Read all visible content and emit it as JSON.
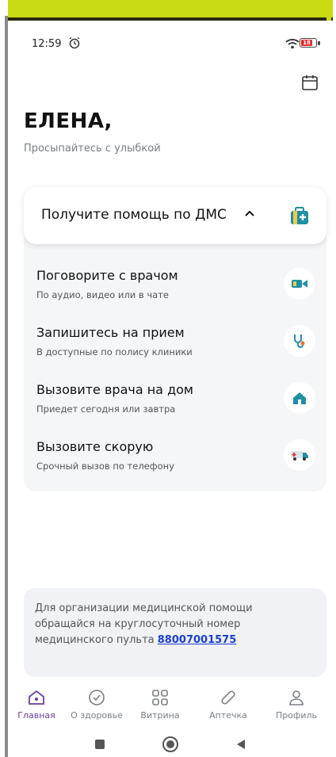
{
  "status_bar": {
    "time": "12:59",
    "battery_level": "18"
  },
  "greeting": {
    "name": "ЕЛЕНА,",
    "subtitle": "Просыпайтесь с улыбкой"
  },
  "dms": {
    "title": "Получите помощь по ДМС",
    "services": [
      {
        "title": "Поговорите с врачом",
        "subtitle": "По аудио, видео или в чате",
        "icon": "video-camera-icon"
      },
      {
        "title": "Запишитесь на прием",
        "subtitle": "В доступные по полису клиники",
        "icon": "stethoscope-icon"
      },
      {
        "title": "Вызовите врача на дом",
        "subtitle": "Приедет сегодня или завтра",
        "icon": "house-icon"
      },
      {
        "title": "Вызовите скорую",
        "subtitle": "Срочный вызов по телефону",
        "icon": "ambulance-icon"
      }
    ]
  },
  "info": {
    "text": "Для организации медицинской помощи обращайся на круглосуточный номер медицинского пульта",
    "phone": "88007001575"
  },
  "bottom_nav": {
    "items": [
      {
        "label": "Главная",
        "icon": "home-icon",
        "active": true
      },
      {
        "label": "О здоровье",
        "icon": "check-circle-icon",
        "active": false
      },
      {
        "label": "Витрина",
        "icon": "grid-icon",
        "active": false
      },
      {
        "label": "Аптечка",
        "icon": "pill-icon",
        "active": false
      },
      {
        "label": "Профиль",
        "icon": "user-icon",
        "active": false
      }
    ]
  },
  "colors": {
    "accent": "#6b3fa0",
    "link": "#1a3fd1",
    "teal": "#1f8fa3",
    "banner": "#c9db12"
  }
}
